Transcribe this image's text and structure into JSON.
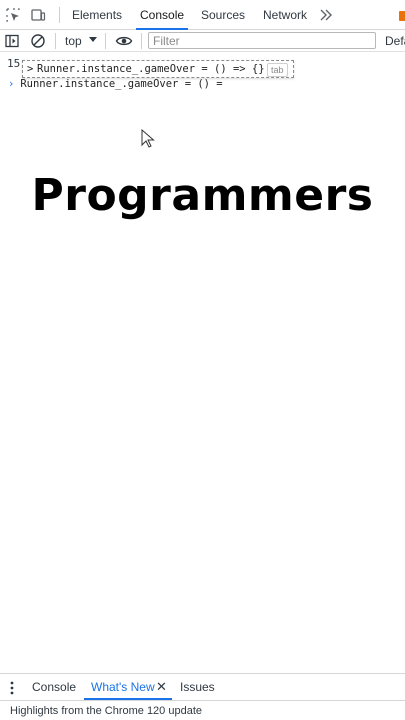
{
  "tabs": {
    "elements": "Elements",
    "console": "Console",
    "sources": "Sources",
    "network": "Network"
  },
  "toolbar": {
    "context": "top",
    "filter_placeholder": "Filter",
    "levels": "Default levels"
  },
  "console": {
    "line_count": "15",
    "autocomplete_text": "Runner.instance_.gameOver = () => {}",
    "autocomplete_hint": "tab",
    "prompt_text": "Runner.instance_.gameOver = () ="
  },
  "overlay": {
    "headline": "Programmers"
  },
  "drawer": {
    "tabs": [
      "Console",
      "What's New",
      "Issues"
    ],
    "close_glyph": "✕",
    "body": "Highlights from the Chrome 120 update"
  },
  "colors": {
    "accent": "#1a73e8",
    "warning": "#e8710a"
  }
}
